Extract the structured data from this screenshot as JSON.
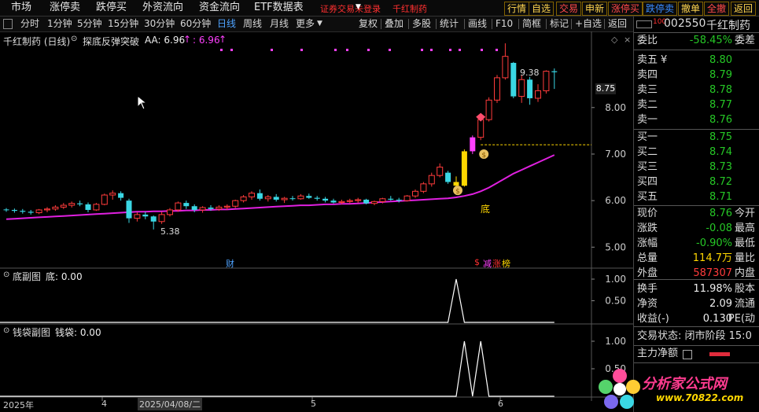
{
  "menu": {
    "items": [
      "市场",
      "涨停卖",
      "跌停买",
      "外资流向",
      "资金流向",
      "ETF数据表"
    ],
    "login_text": "证券交易未登录",
    "stock_name": "千红制药",
    "quick_buttons": [
      {
        "label": "行情",
        "color": "#ffd54f"
      },
      {
        "label": "自选",
        "color": "#ffd54f"
      },
      {
        "label": "交易",
        "color": "#ff4a4a"
      },
      {
        "label": "申新",
        "color": "#ffd54f"
      },
      {
        "label": "涨停买",
        "color": "#ff4a4a"
      },
      {
        "label": "跌停卖",
        "color": "#3a8cff"
      },
      {
        "label": "撤单",
        "color": "#ffd54f"
      },
      {
        "label": "全撤",
        "color": "#ff4a4a"
      },
      {
        "label": "返回",
        "color": "#ffd54f"
      }
    ]
  },
  "toolbar": {
    "periods": [
      "分时",
      "1分钟",
      "5分钟",
      "15分钟",
      "30分钟",
      "60分钟",
      "日线",
      "周线",
      "月线",
      "更多"
    ],
    "active_period": "日线",
    "right_buttons": [
      "复权",
      "叠加",
      "多股",
      "统计",
      "画线",
      "F10",
      "简框",
      "标记",
      "+自选",
      "返回"
    ]
  },
  "main_chart": {
    "stock_title": "千红制药 (日线)",
    "indicator_name": "探底反弹突破",
    "aa_label": "AA: 6.96",
    "aa_arrow": "↑",
    "aa_value2": ": 6.96",
    "current_price_tag": "8.75",
    "high_label": "9.38",
    "low_label": "5.38",
    "bottom_marker": "底",
    "fin_marker": "财",
    "tags": [
      "$",
      "减",
      "涨",
      "榜"
    ]
  },
  "sub1": {
    "title": "底副图",
    "value_label": "底: 0.00"
  },
  "sub2": {
    "title": "钱袋副图",
    "value_label": "钱袋: 0.00"
  },
  "xaxis": {
    "labels": [
      "2025年",
      "4",
      "2025/04/08/二",
      "5",
      "6"
    ]
  },
  "chart_data": {
    "type": "candlestick",
    "y_ticks": [
      5.0,
      6.0,
      7.0,
      8.0
    ],
    "ylim": [
      4.6,
      9.5
    ],
    "candles": [
      [
        5.81,
        5.84,
        5.76,
        5.8
      ],
      [
        5.8,
        5.83,
        5.74,
        5.78
      ],
      [
        5.78,
        5.82,
        5.72,
        5.76
      ],
      [
        5.76,
        5.8,
        5.7,
        5.74
      ],
      [
        5.74,
        5.82,
        5.71,
        5.8
      ],
      [
        5.8,
        5.86,
        5.75,
        5.82
      ],
      [
        5.82,
        5.9,
        5.78,
        5.86
      ],
      [
        5.86,
        5.95,
        5.82,
        5.9
      ],
      [
        5.9,
        5.98,
        5.85,
        5.94
      ],
      [
        5.94,
        6.0,
        5.88,
        5.92
      ],
      [
        5.92,
        5.96,
        5.75,
        5.8
      ],
      [
        5.8,
        5.95,
        5.78,
        5.92
      ],
      [
        5.92,
        6.15,
        5.9,
        6.12
      ],
      [
        6.12,
        6.22,
        6.02,
        6.16
      ],
      [
        6.16,
        6.2,
        6.0,
        6.06
      ],
      [
        6.0,
        6.04,
        5.52,
        5.62
      ],
      [
        5.62,
        5.75,
        5.55,
        5.7
      ],
      [
        5.7,
        5.76,
        5.6,
        5.66
      ],
      [
        5.66,
        5.68,
        5.38,
        5.55
      ],
      [
        5.55,
        5.76,
        5.5,
        5.7
      ],
      [
        5.7,
        5.84,
        5.66,
        5.8
      ],
      [
        5.8,
        5.98,
        5.76,
        5.95
      ],
      [
        5.95,
        6.0,
        5.82,
        5.88
      ],
      [
        5.88,
        5.92,
        5.75,
        5.8
      ],
      [
        5.8,
        5.88,
        5.74,
        5.85
      ],
      [
        5.85,
        5.9,
        5.78,
        5.82
      ],
      [
        5.82,
        5.9,
        5.78,
        5.86
      ],
      [
        5.86,
        5.92,
        5.8,
        5.88
      ],
      [
        5.88,
        6.02,
        5.84,
        6.0
      ],
      [
        6.0,
        6.12,
        5.96,
        6.08
      ],
      [
        6.08,
        6.2,
        6.02,
        6.16
      ],
      [
        6.16,
        6.24,
        6.0,
        6.04
      ],
      [
        6.04,
        6.12,
        5.98,
        6.08
      ],
      [
        6.08,
        6.14,
        5.98,
        6.02
      ],
      [
        6.02,
        6.08,
        5.95,
        6.05
      ],
      [
        6.05,
        6.1,
        6.0,
        6.04
      ],
      [
        6.04,
        6.14,
        6.02,
        6.1
      ],
      [
        6.1,
        6.15,
        6.04,
        6.06
      ],
      [
        6.06,
        6.1,
        6.0,
        6.04
      ],
      [
        6.04,
        6.08,
        5.96,
        6.0
      ],
      [
        6.0,
        6.04,
        5.94,
        5.96
      ],
      [
        5.96,
        6.02,
        5.92,
        5.98
      ],
      [
        5.98,
        6.04,
        5.94,
        6.0
      ],
      [
        6.0,
        6.06,
        5.95,
        6.02
      ],
      [
        6.02,
        6.04,
        5.92,
        5.94
      ],
      [
        5.94,
        6.0,
        5.9,
        5.98
      ],
      [
        5.98,
        6.06,
        5.94,
        6.04
      ],
      [
        6.04,
        6.1,
        6.0,
        6.02
      ],
      [
        6.02,
        6.06,
        5.96,
        6.0
      ],
      [
        6.0,
        6.12,
        5.98,
        6.1
      ],
      [
        6.1,
        6.24,
        6.06,
        6.2
      ],
      [
        6.2,
        6.4,
        6.16,
        6.36
      ],
      [
        6.36,
        6.6,
        6.3,
        6.54
      ],
      [
        6.54,
        6.8,
        6.5,
        6.72
      ],
      [
        6.6,
        6.64,
        6.36,
        6.4
      ],
      [
        6.4,
        6.52,
        6.24,
        6.32
      ],
      [
        6.32,
        7.1,
        6.3,
        7.06
      ],
      [
        7.06,
        7.4,
        7.0,
        7.36
      ],
      [
        7.36,
        7.8,
        7.3,
        7.74
      ],
      [
        7.74,
        8.22,
        7.7,
        8.16
      ],
      [
        8.16,
        8.7,
        8.1,
        8.64
      ],
      [
        8.64,
        9.38,
        8.6,
        9.1
      ],
      [
        8.96,
        8.98,
        8.2,
        8.24
      ],
      [
        8.24,
        8.7,
        8.1,
        8.6
      ],
      [
        8.6,
        8.66,
        8.06,
        8.2
      ],
      [
        8.2,
        8.5,
        8.12,
        8.36
      ],
      [
        8.36,
        8.8,
        8.3,
        8.78
      ],
      [
        8.78,
        8.84,
        8.4,
        8.76
      ]
    ],
    "ma_line": [
      5.6,
      5.61,
      5.62,
      5.63,
      5.64,
      5.65,
      5.66,
      5.67,
      5.68,
      5.69,
      5.7,
      5.71,
      5.72,
      5.73,
      5.74,
      5.75,
      5.76,
      5.76,
      5.77,
      5.77,
      5.78,
      5.78,
      5.79,
      5.79,
      5.8,
      5.8,
      5.81,
      5.81,
      5.82,
      5.83,
      5.84,
      5.85,
      5.86,
      5.87,
      5.88,
      5.89,
      5.9,
      5.9,
      5.91,
      5.92,
      5.92,
      5.93,
      5.93,
      5.94,
      5.95,
      5.96,
      5.97,
      5.98,
      5.99,
      6.0,
      6.01,
      6.02,
      6.03,
      6.04,
      6.05,
      6.07,
      6.1,
      6.14,
      6.2,
      6.28,
      6.38,
      6.48,
      6.58,
      6.66,
      6.74,
      6.82,
      6.9,
      6.98
    ],
    "hline_value": 7.2,
    "sub1_ticks": [
      0.0,
      0.5,
      1.0
    ],
    "sub1_series": {
      "name": "底",
      "nonzero_index": 55,
      "peak": 1.0
    },
    "sub2_ticks": [
      0.0,
      0.5,
      1.0
    ],
    "sub2_series": {
      "name": "钱袋",
      "peaks": [
        56,
        58
      ],
      "peak": 1.0
    },
    "signal_bars": [
      55,
      56
    ]
  },
  "right_panel": {
    "code": "002550",
    "name": "千红制药",
    "weibi_label": "委比",
    "weibi": "-58.45%",
    "weicha_label": "委差",
    "sells": [
      [
        "卖五",
        "8.80",
        "¥"
      ],
      [
        "卖四",
        "8.79",
        ""
      ],
      [
        "卖三",
        "8.78",
        ""
      ],
      [
        "卖二",
        "8.77",
        ""
      ],
      [
        "卖一",
        "8.76",
        ""
      ]
    ],
    "buys": [
      [
        "买一",
        "8.75"
      ],
      [
        "买二",
        "8.74"
      ],
      [
        "买三",
        "8.73"
      ],
      [
        "买四",
        "8.72"
      ],
      [
        "买五",
        "8.71"
      ]
    ],
    "stats": [
      {
        "label": "现价",
        "value": "8.76",
        "color": "#26c726",
        "unit": "今开"
      },
      {
        "label": "涨跌",
        "value": "-0.08",
        "color": "#26c726",
        "unit": "最高"
      },
      {
        "label": "涨幅",
        "value": "-0.90%",
        "color": "#26c726",
        "unit": "最低"
      },
      {
        "label": "总量",
        "value": "114.7万",
        "color": "#ffd700",
        "unit": "量比"
      },
      {
        "label": "外盘",
        "value": "587307",
        "color": "#ff3b3b",
        "unit": "内盘"
      }
    ],
    "stats2": [
      {
        "label": "换手",
        "value": "11.98%",
        "unit": "股本"
      },
      {
        "label": "净资",
        "value": "2.09",
        "unit": "流通"
      },
      {
        "label": "收益(-)",
        "value": "0.130",
        "unit": "PE(动"
      }
    ],
    "trade_status": "交易状态: 闭市阶段 15:0",
    "main_flow": "主力净额",
    "watermark": "分析家公式网",
    "watermark_url": "www.70822.com"
  }
}
